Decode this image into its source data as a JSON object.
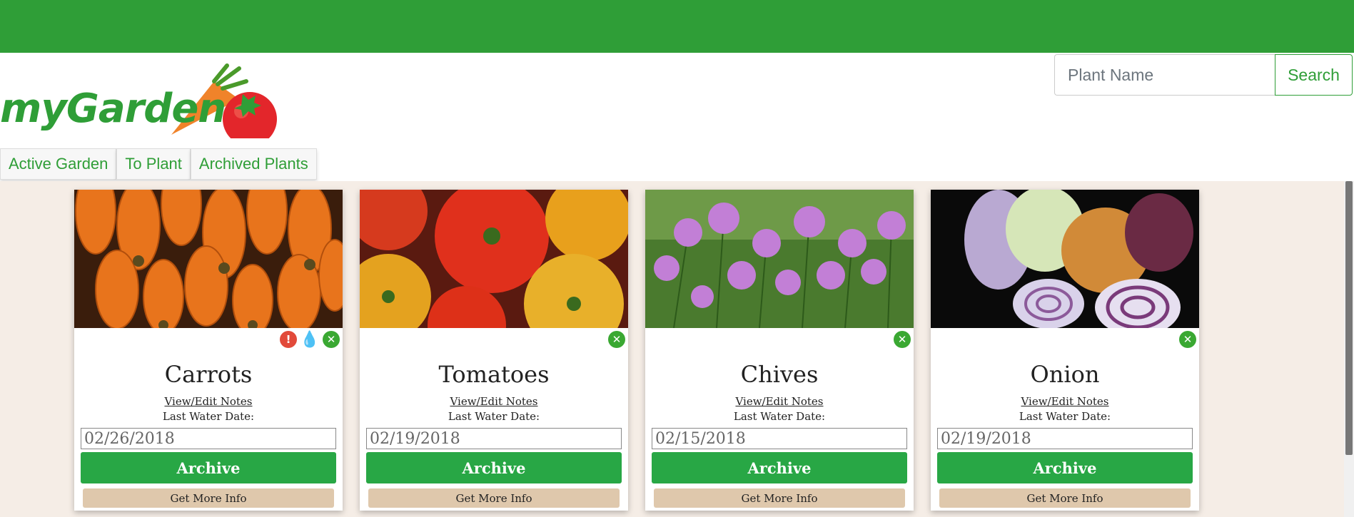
{
  "header": {
    "logo_text": "myGarden",
    "search": {
      "placeholder": "Plant Name",
      "value": "",
      "button_label": "Search"
    }
  },
  "tabs": [
    {
      "label": "Active Garden"
    },
    {
      "label": "To Plant"
    },
    {
      "label": "Archived Plants"
    }
  ],
  "cards": [
    {
      "name": "Carrots",
      "notes_link": "View/Edit Notes",
      "water_label": "Last Water Date:",
      "last_water_date": "02/26/2018",
      "archive_label": "Archive",
      "info_label": "Get More Info",
      "icons": [
        "warning-icon",
        "water-drop-icon",
        "close-icon"
      ]
    },
    {
      "name": "Tomatoes",
      "notes_link": "View/Edit Notes",
      "water_label": "Last Water Date:",
      "last_water_date": "02/19/2018",
      "archive_label": "Archive",
      "info_label": "Get More Info",
      "icons": [
        "close-icon"
      ]
    },
    {
      "name": "Chives",
      "notes_link": "View/Edit Notes",
      "water_label": "Last Water Date:",
      "last_water_date": "02/15/2018",
      "archive_label": "Archive",
      "info_label": "Get More Info",
      "icons": [
        "close-icon"
      ]
    },
    {
      "name": "Onion",
      "notes_link": "View/Edit Notes",
      "water_label": "Last Water Date:",
      "last_water_date": "02/19/2018",
      "archive_label": "Archive",
      "info_label": "Get More Info",
      "icons": [
        "close-icon"
      ]
    }
  ],
  "colors": {
    "brand_green": "#2f9e37",
    "archive_green": "#28a745",
    "info_tan": "#dfc8ac",
    "page_bg": "#f5ede6",
    "warn_red": "#e24a3a",
    "water_blue": "#3a9ad9"
  }
}
